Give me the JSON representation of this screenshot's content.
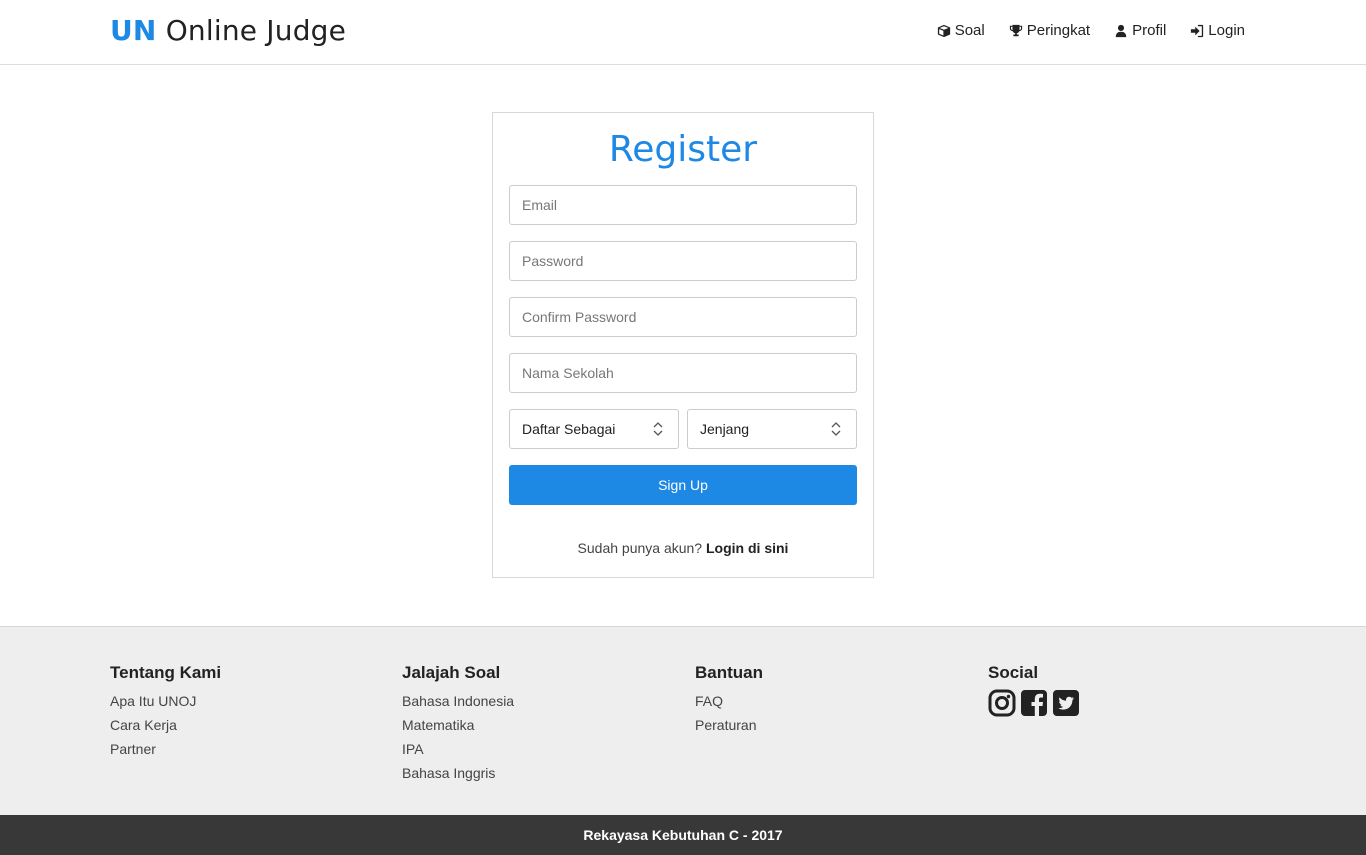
{
  "brand": {
    "prefix": "UN",
    "suffix": "Online Judge"
  },
  "nav": [
    {
      "label": "Soal",
      "icon": "cube-icon"
    },
    {
      "label": "Peringkat",
      "icon": "trophy-icon"
    },
    {
      "label": "Profil",
      "icon": "user-icon"
    },
    {
      "label": "Login",
      "icon": "sign-in-icon"
    }
  ],
  "register": {
    "title": "Register",
    "email_placeholder": "Email",
    "password_placeholder": "Password",
    "confirm_placeholder": "Confirm Password",
    "school_placeholder": "Nama Sekolah",
    "role_select": "Daftar Sebagai",
    "level_select": "Jenjang",
    "signup_label": "Sign Up",
    "login_prompt": "Sudah punya akun?",
    "login_link": "Login di sini"
  },
  "footer": {
    "columns": [
      {
        "title": "Tentang Kami",
        "links": [
          "Apa Itu UNOJ",
          "Cara Kerja",
          "Partner"
        ]
      },
      {
        "title": "Jalajah Soal",
        "links": [
          "Bahasa Indonesia",
          "Matematika",
          "IPA",
          "Bahasa Inggris"
        ]
      },
      {
        "title": "Bantuan",
        "links": [
          "FAQ",
          "Peraturan"
        ]
      },
      {
        "title": "Social",
        "icons": [
          "instagram-icon",
          "facebook-icon",
          "twitter-icon"
        ]
      }
    ]
  },
  "copyright": "Rekayasa Kebutuhan C - 2017",
  "colors": {
    "accent": "#1e88e5",
    "footer_bg": "#eeeeee",
    "bottom_bar": "#383838"
  }
}
